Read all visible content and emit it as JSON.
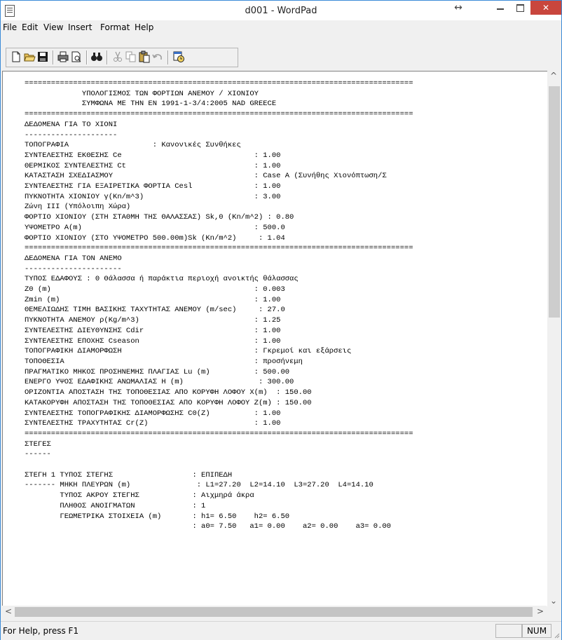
{
  "window": {
    "title": "d001 - WordPad",
    "restore_glyph": "↔",
    "close_glyph": "✕"
  },
  "menu": [
    "File",
    "Edit",
    "View",
    "Insert",
    "Format",
    "Help"
  ],
  "toolbar_icons": [
    "new-document-icon",
    "open-folder-icon",
    "save-disk-icon",
    "print-icon",
    "print-preview-icon",
    "find-binoculars-icon",
    "cut-scissors-icon",
    "copy-icon",
    "paste-icon",
    "undo-icon",
    "date-time-icon"
  ],
  "document": {
    "lines": [
      "========================================================================================",
      "             ΥΠΟΛΟΓΙΣΜΟΣ ΤΩΝ ΦΟΡΤΙΩΝ ΑΝΕΜΟΥ / ΧΙΟΝΙΟΥ",
      "             ΣΥΜΦΩΝΑ ΜΕ ΤΗΝ ΕΝ 1991-1-3/4:2005 NAD GREECE",
      "========================================================================================",
      "ΔΕΔΟΜΕΝΑ ΓΙΑ ΤΟ ΧΙΟΝΙ",
      "---------------------",
      "ΤΟΠΟΓΡΑΦΙΑ                   : Κανονικές Συνθήκες",
      "ΣΥΝΤΕΛΕΣΤΗΣ ΕΚΘΕΣΗΣ Ce                              : 1.00",
      "ΘΕΡΜΙΚΟΣ ΣΥΝΤΕΛΕΣΤΗΣ Ct                             : 1.00",
      "ΚΑΤΑΣΤΑΣΗ ΣΧΕΔΙΑΣΜΟΥ                                : Case A (Συνήθης Χιονόπτωση/Σ",
      "ΣΥΝΤΕΛΕΣΤΗΣ ΓΙΑ ΕΞΑΙΡΕΤΙΚΑ ΦΟΡΤΙΑ Cesl              : 1.00",
      "ΠΥΚΝΟΤΗΤΑ ΧΙΟΝΙΟΥ γ(Kn/m^3)                         : 3.00",
      "Ζώνη ΙΙΙ (Υπόλοιπη Χώρα)",
      "ΦΟΡΤΙΟ ΧΙΟΝΙΟΥ (ΣΤΗ ΣΤΑΘΜΗ ΤΗΣ ΘΑΛΑΣΣΑΣ) Sk,0 (Kn/m^2) : 0.80",
      "ΥΨΟΜΕΤΡΟ Α(m)                                       : 500.0",
      "ΦΟΡΤΙΟ ΧΙΟΝΙΟΥ (ΣΤΟ ΥΨΟΜΕΤΡΟ 500.00m)Sk (Kn/m^2)     : 1.04",
      "========================================================================================",
      "ΔΕΔΟΜΕΝΑ ΓΙΑ ΤΟΝ ΑΝΕΜΟ",
      "----------------------",
      "ΤΥΠΟΣ ΕΔΑΦΟΥΣ : 0 Θάλασσα ή παράκτια περιοχή ανοικτής θάλασσας",
      "Z0 (m)                                              : 0.003",
      "Zmin (m)                                            : 1.00",
      "ΘΕΜΕΛΙΩΔΗΣ ΤΙΜΗ ΒΑΣΙΚΗΣ ΤΑΧΥΤΗΤΑΣ ΑΝΕΜΟΥ (m/sec)     : 27.0",
      "ΠΥΚΝΟΤΗΤΑ ΑΝΕΜΟΥ ρ(Kg/m^3)                          : 1.25",
      "ΣΥΝΤΕΛΕΣΤΗΣ ΔΙΕΥΘΥΝΣΗΣ Cdir                         : 1.00",
      "ΣΥΝΤΕΛΕΣΤΗΣ ΕΠΟΧΗΣ Cseason                          : 1.00",
      "ΤΟΠΟΓΡΑΦΙΚΗ ΔΙΑΜΟΡΦΩΣΗ                              : Γκρεμοί και εξάρσεις",
      "ΤΟΠΟΘΕΣΙΑ                                           : προσήνεμη",
      "ΠΡΑΓΜΑΤΙΚΟ ΜΗΚΟΣ ΠΡΟΣΗΝΕΜΗΣ ΠΛΑΓΙΑΣ Lu (m)          : 500.00",
      "ΕΝΕΡΓΟ ΥΨΟΣ ΕΔΑΦΙΚΗΣ ΑΝΩΜΑΛΙΑΣ Η (m)                 : 300.00",
      "ΟΡΙΖΟΝΤΙΑ ΑΠΟΣΤΑΣΗ ΤΗΣ ΤΟΠΟΘΕΣΙΑΣ ΑΠΟ ΚΟΡΥΦΗ ΛΟΦΟΥ X(m)  : 150.00",
      "ΚΑΤΑΚΟΡΥΦΗ ΑΠΟΣΤΑΣΗ ΤΗΣ ΤΟΠΟΘΕΣΙΑΣ ΑΠΟ ΚΟΡΥΦΗ ΛΟΦΟΥ Z(m) : 150.00",
      "ΣΥΝΤΕΛΕΣΤΗΣ ΤΟΠΟΓΡΑΦΙΚΗΣ ΔΙΑΜΟΡΦΩΣΗΣ C0(Z)          : 1.00",
      "ΣΥΝΤΕΛΕΣΤΗΣ ΤΡΑΧΥΤΗΤΑΣ Cr(Z)                        : 1.00",
      "========================================================================================",
      "ΣΤΕΓΕΣ",
      "------",
      "",
      "ΣΤΕΓΗ 1 ΤΥΠΟΣ ΣΤΕΓΗΣ                  : ΕΠΙΠΕΔΗ",
      "------- ΜΗΚΗ ΠΛΕΥΡΩΝ (m)               : L1=27.20  L2=14.10  L3=27.20  L4=14.10",
      "        ΤΥΠΟΣ ΑΚΡΟΥ ΣΤΕΓΗΣ            : Αιχμηρά άκρα",
      "        ΠΛΗΘΟΣ ΑΝΟΙΓΜΑΤΩΝ             : 1",
      "        ΓΕΩΜΕΤΡΙΚΑ ΣΤΟΙΧΕΙΑ (m)       : h1= 6.50    h2= 6.50",
      "                                      : a0= 7.50   a1= 0.00    a2= 0.00    a3= 0.00"
    ]
  },
  "status": {
    "help_text": "For Help, press F1",
    "indicator": "NUM"
  }
}
